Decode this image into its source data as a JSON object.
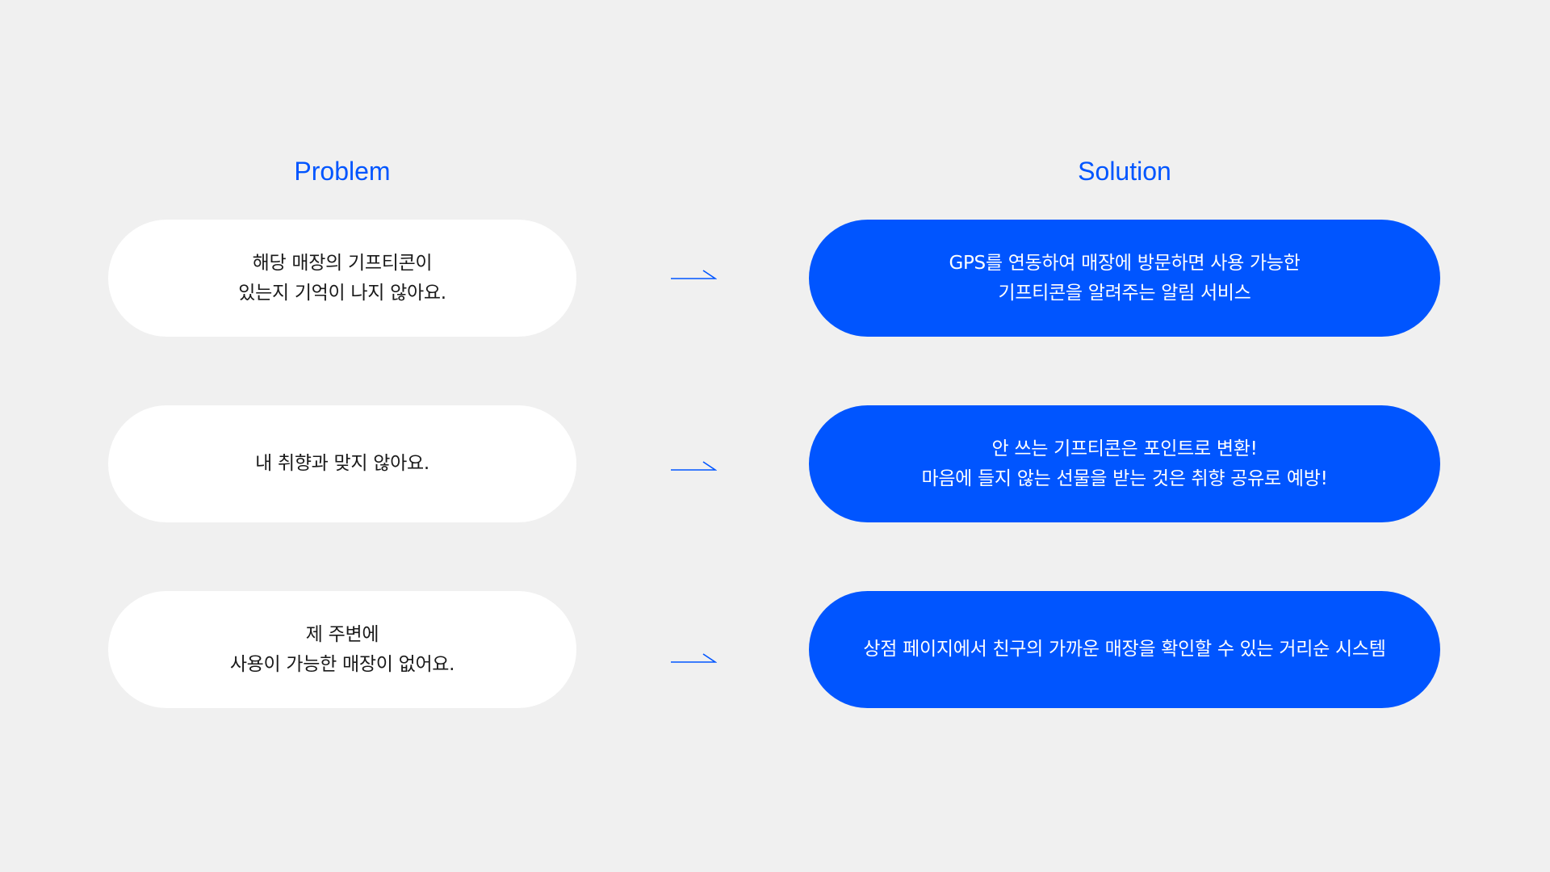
{
  "headings": {
    "problem": "Problem",
    "solution": "Solution"
  },
  "rows": [
    {
      "problem": "해당 매장의 기프티콘이\n있는지 기억이 나지 않아요.",
      "solution": "GPS를 연동하여 매장에 방문하면 사용 가능한\n기프티콘을 알려주는 알림 서비스"
    },
    {
      "problem": "내 취향과 맞지 않아요.",
      "solution": "안 쓰는 기프티콘은 포인트로 변환!\n마음에 들지 않는 선물을 받는 것은 취향 공유로 예방!"
    },
    {
      "problem": "제 주변에\n사용이 가능한 매장이 없어요.",
      "solution": "상점 페이지에서 친구의 가까운 매장을 확인할 수 있는 거리순 시스템"
    }
  ],
  "colors": {
    "accent": "#0055ff",
    "background": "#f0f0f0",
    "problem_pill": "#ffffff",
    "problem_text": "#1a1a1a",
    "solution_text": "#ffffff"
  },
  "icons": {
    "arrow": "right-arrow-icon"
  }
}
